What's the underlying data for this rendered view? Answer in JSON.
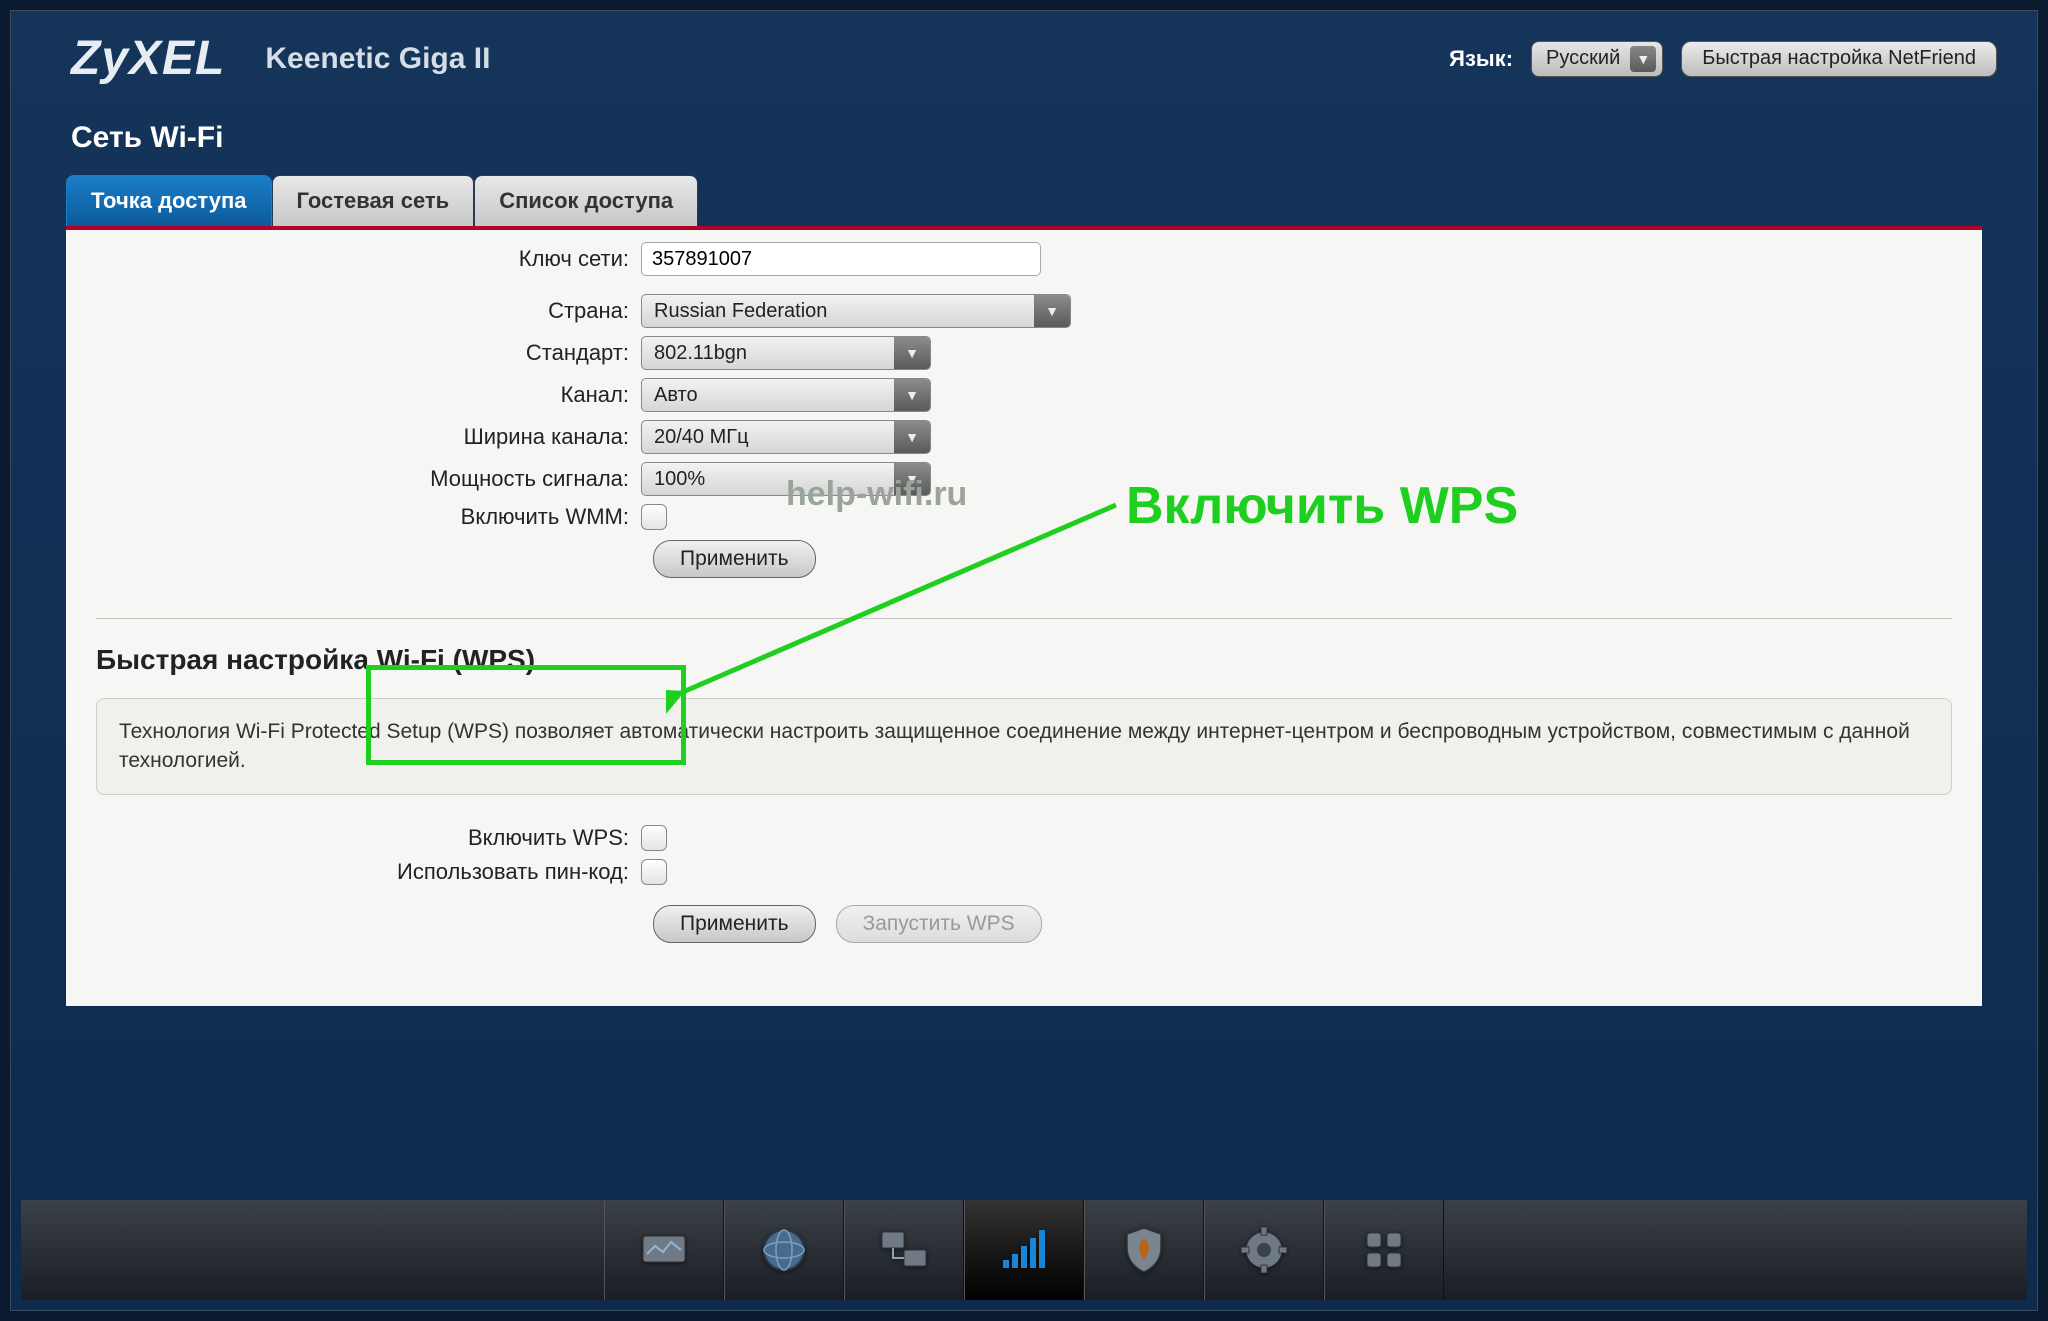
{
  "header": {
    "logo": "ZyXEL",
    "model": "Keenetic Giga II",
    "lang_label": "Язык:",
    "lang_value": "Русский",
    "quick_setup": "Быстрая настройка NetFriend"
  },
  "page_title": "Сеть Wi-Fi",
  "tabs": [
    {
      "label": "Точка доступа",
      "active": true
    },
    {
      "label": "Гостевая сеть",
      "active": false
    },
    {
      "label": "Список доступа",
      "active": false
    }
  ],
  "form": {
    "network_key_label": "Ключ сети:",
    "network_key_value": "357891007",
    "country_label": "Страна:",
    "country_value": "Russian Federation",
    "standard_label": "Стандарт:",
    "standard_value": "802.11bgn",
    "channel_label": "Канал:",
    "channel_value": "Авто",
    "width_label": "Ширина канала:",
    "width_value": "20/40 МГц",
    "power_label": "Мощность сигнала:",
    "power_value": "100%",
    "wmm_label": "Включить WMM:",
    "apply": "Применить"
  },
  "wps": {
    "heading": "Быстрая настройка Wi-Fi (WPS)",
    "info": "Технология Wi-Fi Protected Setup (WPS) позволяет автоматически настроить защищенное соединение между интернет-центром и беспроводным устройством, совместимым с данной технологией.",
    "enable_label": "Включить WPS:",
    "pin_label": "Использовать пин-код:",
    "apply": "Применить",
    "start": "Запустить WPS"
  },
  "watermark": "help-wifi.ru",
  "annotation": "Включить  WPS"
}
